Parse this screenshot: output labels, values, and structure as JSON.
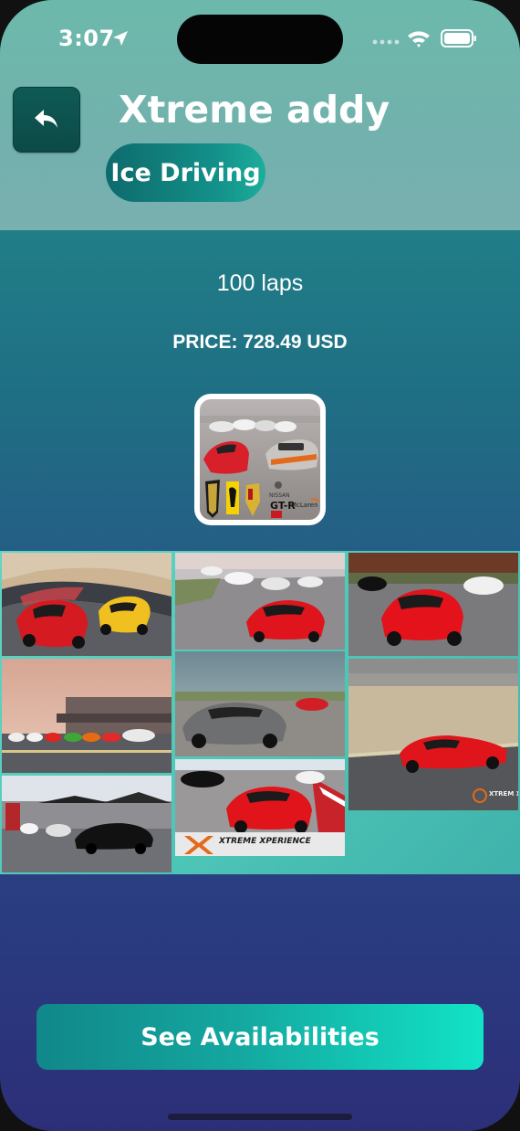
{
  "status_bar": {
    "time": "3:07"
  },
  "header": {
    "title": "Xtreme addy",
    "category": "Ice Driving"
  },
  "details": {
    "laps": "100 laps",
    "price": "PRICE: 728.49 USD"
  },
  "thumbnail": {
    "logos": [
      "GT-R",
      "NISSAN",
      "McLaren"
    ]
  },
  "gallery": {
    "photos": [
      {
        "name": "ferrari-lamborghini-track"
      },
      {
        "name": "lamborghini-white-cars"
      },
      {
        "name": "ferrari-porsche-track"
      },
      {
        "name": "cars-lined-up-pitlane"
      },
      {
        "name": "grey-lamborghini"
      },
      {
        "name": "red-ferrari-track-turn"
      },
      {
        "name": "cars-under-tents"
      },
      {
        "name": "ferrari-xtreme-xperience"
      }
    ],
    "watermark_text": "XTREME XPERIENCE",
    "corner_watermark": "XTREM XPERI"
  },
  "cta": {
    "label": "See Availabilities"
  },
  "colors": {
    "header_bg": "#72b1ad",
    "accent": "#12e3c6",
    "back_button": "#0f5a56"
  }
}
